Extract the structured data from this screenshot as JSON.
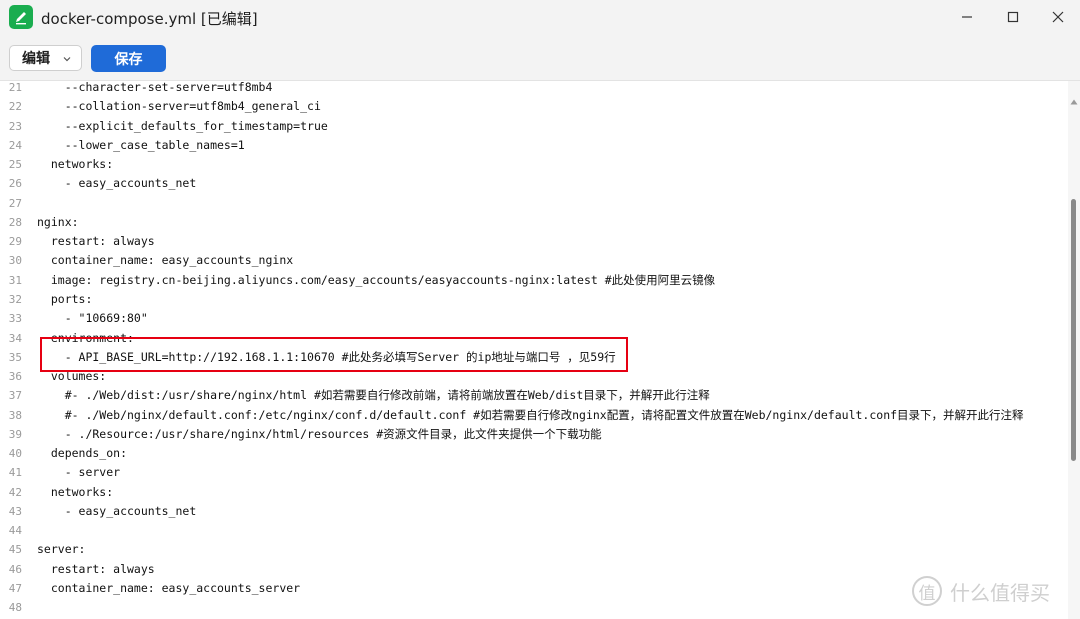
{
  "window": {
    "title": "docker-compose.yml [已编辑]"
  },
  "toolbar": {
    "edit_label": "编辑",
    "save_label": "保存"
  },
  "editor": {
    "lines": [
      {
        "n": "21",
        "text": "    --character-set-server=utf8mb4"
      },
      {
        "n": "22",
        "text": "    --collation-server=utf8mb4_general_ci"
      },
      {
        "n": "23",
        "text": "    --explicit_defaults_for_timestamp=true"
      },
      {
        "n": "24",
        "text": "    --lower_case_table_names=1"
      },
      {
        "n": "25",
        "text": "  networks:"
      },
      {
        "n": "26",
        "text": "    - easy_accounts_net"
      },
      {
        "n": "27",
        "text": ""
      },
      {
        "n": "28",
        "text": "nginx:"
      },
      {
        "n": "29",
        "text": "  restart: always"
      },
      {
        "n": "30",
        "text": "  container_name: easy_accounts_nginx"
      },
      {
        "n": "31",
        "text": "  image: registry.cn-beijing.aliyuncs.com/easy_accounts/easyaccounts-nginx:latest #此处使用阿里云镜像"
      },
      {
        "n": "32",
        "text": "  ports:"
      },
      {
        "n": "33",
        "text": "    - \"10669:80\""
      },
      {
        "n": "34",
        "text": "  environment:"
      },
      {
        "n": "35",
        "text": "    - API_BASE_URL=http://192.168.1.1:10670 #此处务必填写Server 的ip地址与端口号 ，见59行"
      },
      {
        "n": "36",
        "text": "  volumes:"
      },
      {
        "n": "37",
        "text": "    #- ./Web/dist:/usr/share/nginx/html #如若需要自行修改前端，请将前端放置在Web/dist目录下，并解开此行注释"
      },
      {
        "n": "38",
        "text": "    #- ./Web/nginx/default.conf:/etc/nginx/conf.d/default.conf #如若需要自行修改nginx配置，请将配置文件放置在Web/nginx/default.conf目录下，并解开此行注释"
      },
      {
        "n": "39",
        "text": "    - ./Resource:/usr/share/nginx/html/resources #资源文件目录，此文件夹提供一个下载功能"
      },
      {
        "n": "40",
        "text": "  depends_on:"
      },
      {
        "n": "41",
        "text": "    - server"
      },
      {
        "n": "42",
        "text": "  networks:"
      },
      {
        "n": "43",
        "text": "    - easy_accounts_net"
      },
      {
        "n": "44",
        "text": ""
      },
      {
        "n": "45",
        "text": "server:"
      },
      {
        "n": "46",
        "text": "  restart: always"
      },
      {
        "n": "47",
        "text": "  container_name: easy_accounts_server"
      },
      {
        "n": "48",
        "text": ""
      }
    ]
  },
  "watermark": {
    "icon_text": "值",
    "text": "什么值得买"
  },
  "colors": {
    "accent": "#1f6bd8",
    "highlight_border": "#e60012",
    "app_icon": "#1aad4f"
  }
}
